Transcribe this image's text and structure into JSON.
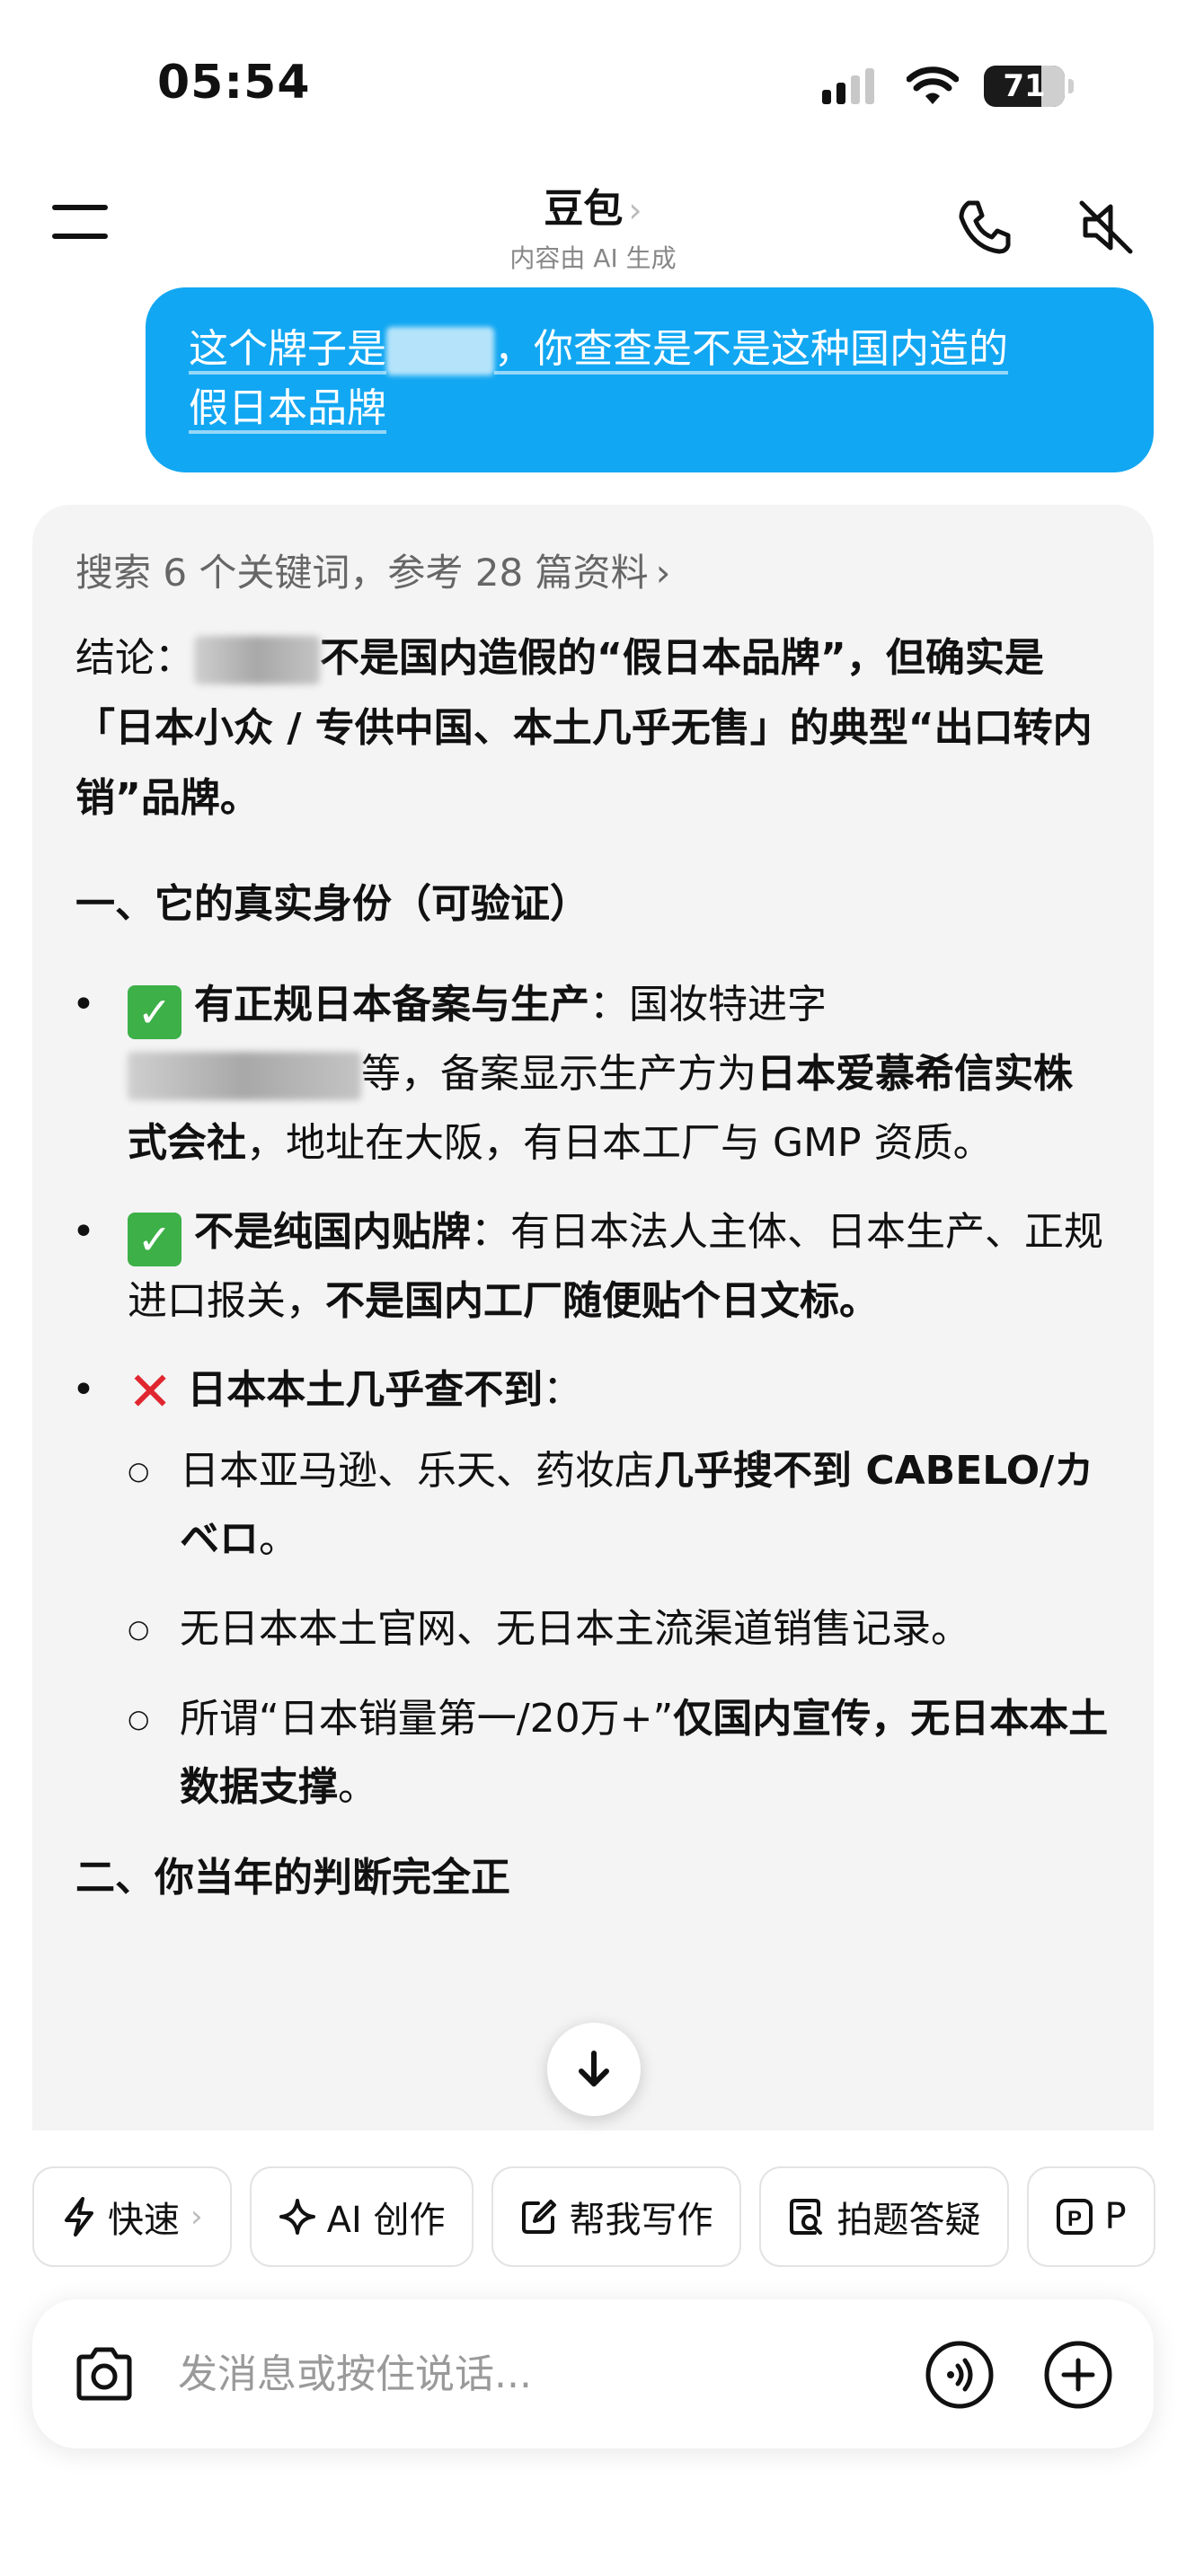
{
  "status_bar": {
    "time": "05:54",
    "battery": "71",
    "battery_level": 0.71
  },
  "nav": {
    "title": "豆包",
    "subtitle": "内容由 AI 生成"
  },
  "user_message": {
    "line1_a": "这个牌子是",
    "line1_b": "，你查查是不是这种国内造的",
    "line2": "假日本品牌"
  },
  "assistant": {
    "search_ref": "搜索 6 个关键词，参考 28 篇资料",
    "conclusion_label": "结论：",
    "conclusion_bold_a": "不是国内造假的“假日本品牌”，但确实是「日本小众 / 专供中国、本土几乎无售」的典型“出口转内销”品牌。",
    "section1": "一、它的真实身份（可验证）",
    "b1_title": "有正规日本备案与生产",
    "b1_colon": "：国妆特进字",
    "b1_text_a": "等，备案显示生产方为",
    "b1_bold": "日本爱慕希信实株式会社",
    "b1_text_b": "，地址在大阪，有日本工厂与 GMP 资质。",
    "b2_title": "不是纯国内贴牌",
    "b2_text": "：有日本法人主体、日本生产、正规进口报关，",
    "b2_bold": "不是国内工厂随便贴个日文标。",
    "b3_title": "日本本土几乎查不到",
    "b3_colon": "：",
    "sub1_text": "日本亚马逊、乐天、药妆店",
    "sub1_bold": "几乎搜不到 CABELO/カベロ",
    "sub1_end": "。",
    "sub2": "无日本本土官网、无日本主流渠道销售记录。",
    "sub3_text": "所谓“日本销量第一/20万+”",
    "sub3_bold": "仅国内宣传，无日本本土数据支撑",
    "sub3_end": "。",
    "section2": "二、你当年的判断完全正"
  },
  "chips": [
    {
      "label": "快速",
      "icon": "bolt-icon"
    },
    {
      "label": "AI 创作",
      "icon": "sparkle-icon"
    },
    {
      "label": "帮我写作",
      "icon": "edit-icon"
    },
    {
      "label": "拍题答疑",
      "icon": "scan-question-icon"
    },
    {
      "label": "P",
      "icon": "p-icon"
    }
  ],
  "input": {
    "placeholder": "发消息或按住说话..."
  }
}
